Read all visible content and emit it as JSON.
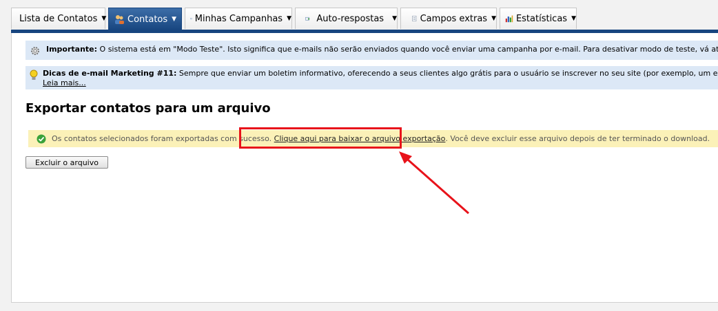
{
  "tabs": [
    {
      "label": "Lista de Contatos",
      "icon": "contact-list-icon",
      "active": false
    },
    {
      "label": "Contatos",
      "icon": "contacts-people-icon",
      "active": true
    },
    {
      "label": "Minhas Campanhas",
      "icon": "envelope-icon",
      "active": false
    },
    {
      "label": "Auto-respostas",
      "icon": "autoresponder-icon",
      "active": false
    },
    {
      "label": "Campos extras",
      "icon": "document-icon",
      "active": false
    },
    {
      "label": "Estatísticas",
      "icon": "bar-chart-icon",
      "active": false
    }
  ],
  "notices": {
    "important": {
      "title": "Importante:",
      "text": " O sistema está em \"Modo Teste\". Isto significa que e-mails não serão enviados quando você enviar uma campanha por e-mail. Para desativar modo de teste, vá até a página Configuraçõ"
    },
    "tip": {
      "title": "Dicas de e-mail Marketing #11:",
      "text": " Sempre que enviar um boletim informativo, oferecendo a seus clientes algo grátis para o usuário se inscrever no seu site (por exemplo, um e-Book ou um relatório e",
      "link": "Leia mais..."
    }
  },
  "page_title": "Exportar contatos para um arquivo",
  "success": {
    "before": "Os contatos selecionados foram exportadas com sucesso. ",
    "link": "Clique aqui para baixar o arquivo exportação",
    "after": ". Você deve excluir esse arquivo depois de ter terminado o download."
  },
  "delete_button": "Excluir o arquivo",
  "colors": {
    "active_tab": "#17457f",
    "notice_bg": "#dce8f6",
    "success_bg": "#fbf1b8",
    "annotation": "#e8121a"
  }
}
